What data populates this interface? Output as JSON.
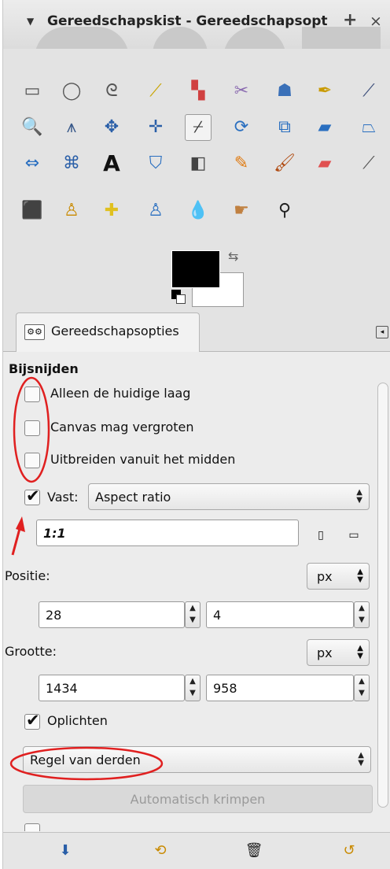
{
  "window": {
    "title": "Gereedschapskist - Gereedschapsopt",
    "add_tab": "+",
    "close": "×",
    "menu_arrow": "▼"
  },
  "toolbox": {
    "tools": [
      {
        "name": "rect-select-icon",
        "glyph": "▭",
        "color": "#555555"
      },
      {
        "name": "ellipse-select-icon",
        "glyph": "◯",
        "color": "#555555"
      },
      {
        "name": "free-select-icon",
        "glyph": "ᘓ",
        "color": "#555555"
      },
      {
        "name": "fuzzy-select-icon",
        "glyph": "⟋",
        "color": "#c9a400"
      },
      {
        "name": "select-by-color-icon",
        "glyph": "▚",
        "color": "#d04040"
      },
      {
        "name": "scissors-select-icon",
        "glyph": "✂",
        "color": "#8a6ab0"
      },
      {
        "name": "foreground-select-icon",
        "glyph": "☗",
        "color": "#3a70b8"
      },
      {
        "name": "paths-icon",
        "glyph": "✒",
        "color": "#c99a00"
      },
      {
        "name": "color-picker-icon",
        "glyph": "⟋",
        "color": "#3b4d7a"
      },
      {
        "name": "zoom-icon",
        "glyph": "🔍",
        "color": "#2a6fc0"
      },
      {
        "name": "measure-icon",
        "glyph": "⩚",
        "color": "#3a5a8a"
      },
      {
        "name": "move-icon",
        "glyph": "✥",
        "color": "#2a5fa8"
      },
      {
        "name": "align-icon",
        "glyph": "✛",
        "color": "#2a5fa8"
      },
      {
        "name": "crop-icon",
        "glyph": "⌿",
        "color": "#333333"
      },
      {
        "name": "rotate-icon",
        "glyph": "⟳",
        "color": "#2a6fc0"
      },
      {
        "name": "scale-icon",
        "glyph": "⧉",
        "color": "#2a6fc0"
      },
      {
        "name": "shear-icon",
        "glyph": "▰",
        "color": "#2a6fc0"
      },
      {
        "name": "perspective-icon",
        "glyph": "⏢",
        "color": "#2a6fc0"
      },
      {
        "name": "flip-icon",
        "glyph": "⇔",
        "color": "#2a6fc0"
      },
      {
        "name": "cage-transform-icon",
        "glyph": "⌘",
        "color": "#2a5fa8"
      },
      {
        "name": "text-icon",
        "glyph": "A",
        "color": "#111111"
      },
      {
        "name": "bucket-fill-icon",
        "glyph": "⛉",
        "color": "#2a6fc0"
      },
      {
        "name": "blend-icon",
        "glyph": "◧",
        "color": "#444444"
      },
      {
        "name": "pencil-icon",
        "glyph": "✎",
        "color": "#e07a10"
      },
      {
        "name": "paintbrush-icon",
        "glyph": "🖌",
        "color": "#b04a10"
      },
      {
        "name": "eraser-icon",
        "glyph": "▰",
        "color": "#e05050"
      },
      {
        "name": "airbrush-icon",
        "glyph": "⟋",
        "color": "#555555"
      },
      {
        "name": "ink-icon",
        "glyph": "⬛",
        "color": "#2a3a5a"
      },
      {
        "name": "clone-icon",
        "glyph": "♙",
        "color": "#c98a00"
      },
      {
        "name": "heal-icon",
        "glyph": "✚",
        "color": "#e0c020"
      },
      {
        "name": "perspective-clone-icon",
        "glyph": "♙",
        "color": "#2a6fc0"
      },
      {
        "name": "blur-sharpen-icon",
        "glyph": "💧",
        "color": "#3a8ad0"
      },
      {
        "name": "smudge-icon",
        "glyph": "☛",
        "color": "#c08040"
      },
      {
        "name": "dodge-burn-icon",
        "glyph": "⚲",
        "color": "#222222"
      }
    ]
  },
  "tab": {
    "label": "Gereedschapsopties",
    "icon_text": "⚙⚙",
    "menu_icon": "◂"
  },
  "options": {
    "section_title": "Bijsnijden",
    "current_layer_only": {
      "label": "Alleen de huidige laag",
      "checked": false
    },
    "allow_growing": {
      "label": "Canvas mag vergroten",
      "checked": false
    },
    "expand_from_center": {
      "label": "Uitbreiden vanuit het midden",
      "checked": false
    },
    "fixed": {
      "label": "Vast:",
      "checked": true,
      "mode": "Aspect ratio"
    },
    "aspect_value": "1:1",
    "position": {
      "label": "Positie:",
      "unit": "px",
      "x": "28",
      "y": "4"
    },
    "size": {
      "label": "Grootte:",
      "unit": "px",
      "w": "1434",
      "h": "958"
    },
    "highlight": {
      "label": "Oplichten",
      "checked": true
    },
    "guides": "Regel van derden",
    "auto_shrink": "Automatisch krimpen"
  },
  "spin_up": "▲",
  "spin_down": "▼",
  "bottom_buttons": [
    {
      "name": "save-options-icon",
      "glyph": "⬇"
    },
    {
      "name": "restore-options-icon",
      "glyph": "⟲"
    },
    {
      "name": "delete-options-icon",
      "glyph": "🗑"
    },
    {
      "name": "reset-options-icon",
      "glyph": "↺"
    }
  ],
  "annotation_color": "#e02020"
}
